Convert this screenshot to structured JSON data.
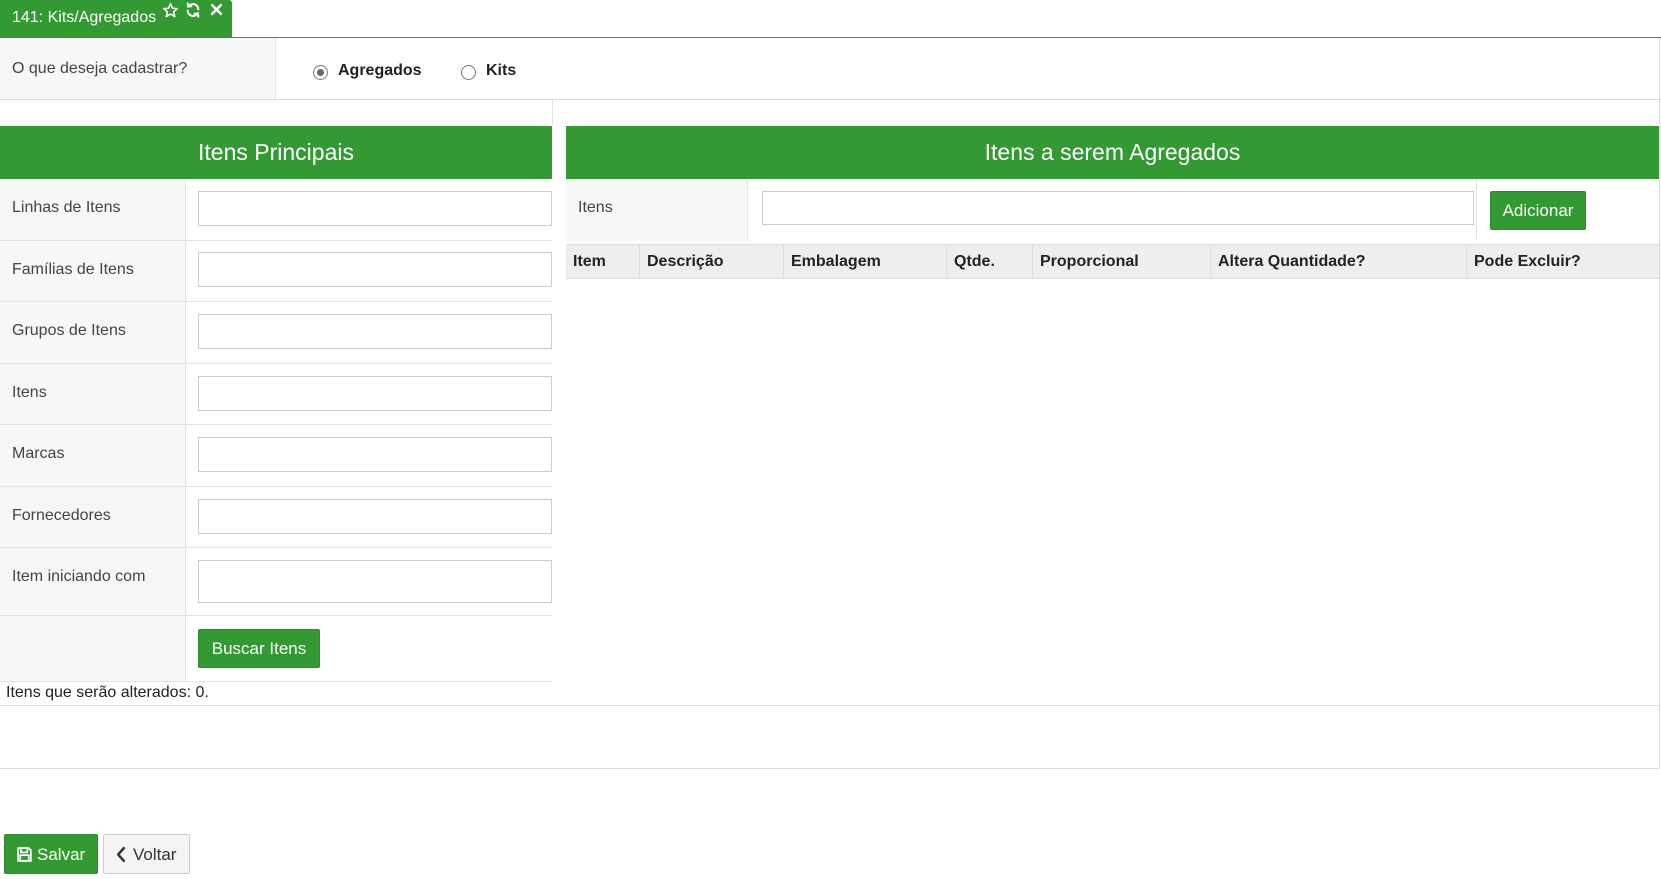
{
  "tab": {
    "title": "141: Kits/Agregados",
    "icons": [
      "star-icon",
      "refresh-icon",
      "close-icon"
    ]
  },
  "question": {
    "label": "O que deseja cadastrar?",
    "options": [
      {
        "label": "Agregados",
        "checked": true
      },
      {
        "label": "Kits",
        "checked": false
      }
    ]
  },
  "left_panel": {
    "title": "Itens Principais",
    "fields": [
      {
        "label": "Linhas de Itens",
        "value": ""
      },
      {
        "label": "Famílias de Itens",
        "value": ""
      },
      {
        "label": "Grupos de Itens",
        "value": ""
      },
      {
        "label": "Itens",
        "value": ""
      },
      {
        "label": "Marcas",
        "value": ""
      },
      {
        "label": "Fornecedores",
        "value": ""
      },
      {
        "label": "Item iniciando com",
        "value": ""
      }
    ],
    "search_button": "Buscar Itens",
    "count_text": "Itens que serão alterados: 0."
  },
  "right_panel": {
    "title": "Itens a serem Agregados",
    "items_label": "Itens",
    "items_value": "",
    "add_button": "Adicionar",
    "columns": [
      "Item",
      "Descrição",
      "Embalagem",
      "Qtde.",
      "Proporcional",
      "Altera Quantidade?",
      "Pode Excluir?"
    ],
    "rows": []
  },
  "footer": {
    "save_label": "Salvar",
    "back_label": "Voltar"
  },
  "colors": {
    "accent": "#339933",
    "label_bg": "#f5f8f5",
    "table_header_bg": "#eeeeee"
  }
}
